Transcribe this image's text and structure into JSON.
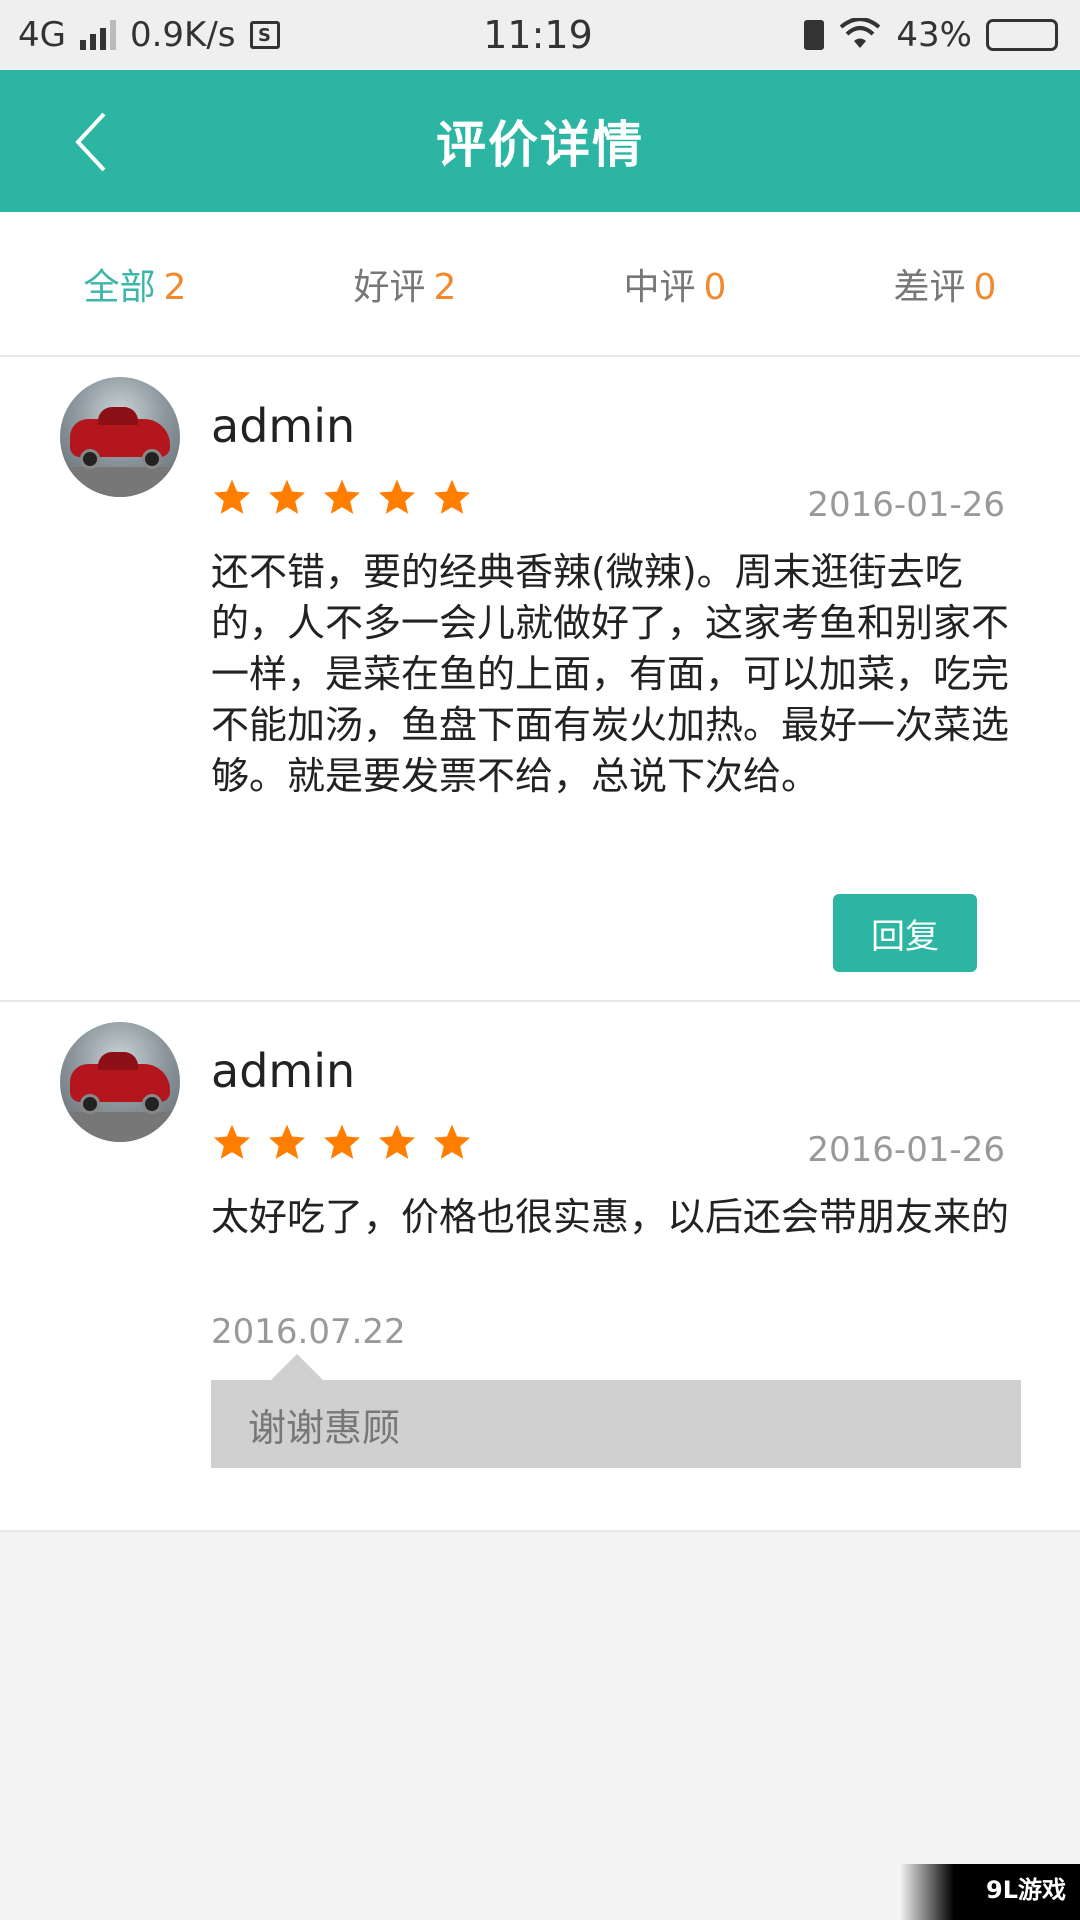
{
  "status_bar": {
    "network": "4G",
    "speed": "0.9K/s",
    "sim_icon": "S",
    "time": "11:19",
    "battery_percent": "43%",
    "battery_level": 0.43
  },
  "header": {
    "title": "评价详情",
    "back_icon": "chevron-left-icon"
  },
  "tabs": [
    {
      "label": "全部",
      "count": "2",
      "active": true
    },
    {
      "label": "好评",
      "count": "2",
      "active": false
    },
    {
      "label": "中评",
      "count": "0",
      "active": false
    },
    {
      "label": "差评",
      "count": "0",
      "active": false
    }
  ],
  "reviews": [
    {
      "username": "admin",
      "rating": 5,
      "date": "2016-01-26",
      "content": "还不错，要的经典香辣(微辣)。周末逛街去吃的，人不多一会儿就做好了，这家考鱼和别家不一样，是菜在鱼的上面，有面，可以加菜，吃完不能加汤，鱼盘下面有炭火加热。最好一次菜选够。就是要发票不给，总说下次给。",
      "reply_button": "回复"
    },
    {
      "username": "admin",
      "rating": 5,
      "date": "2016-01-26",
      "content": "太好吃了，价格也很实惠，以后还会带朋友来的",
      "reply_date": "2016.07.22",
      "reply_text": "谢谢惠顾"
    }
  ],
  "watermark": "9L游戏",
  "colors": {
    "accent": "#2cb5a2",
    "star": "#ff7e00",
    "count": "#ef8a2e"
  }
}
